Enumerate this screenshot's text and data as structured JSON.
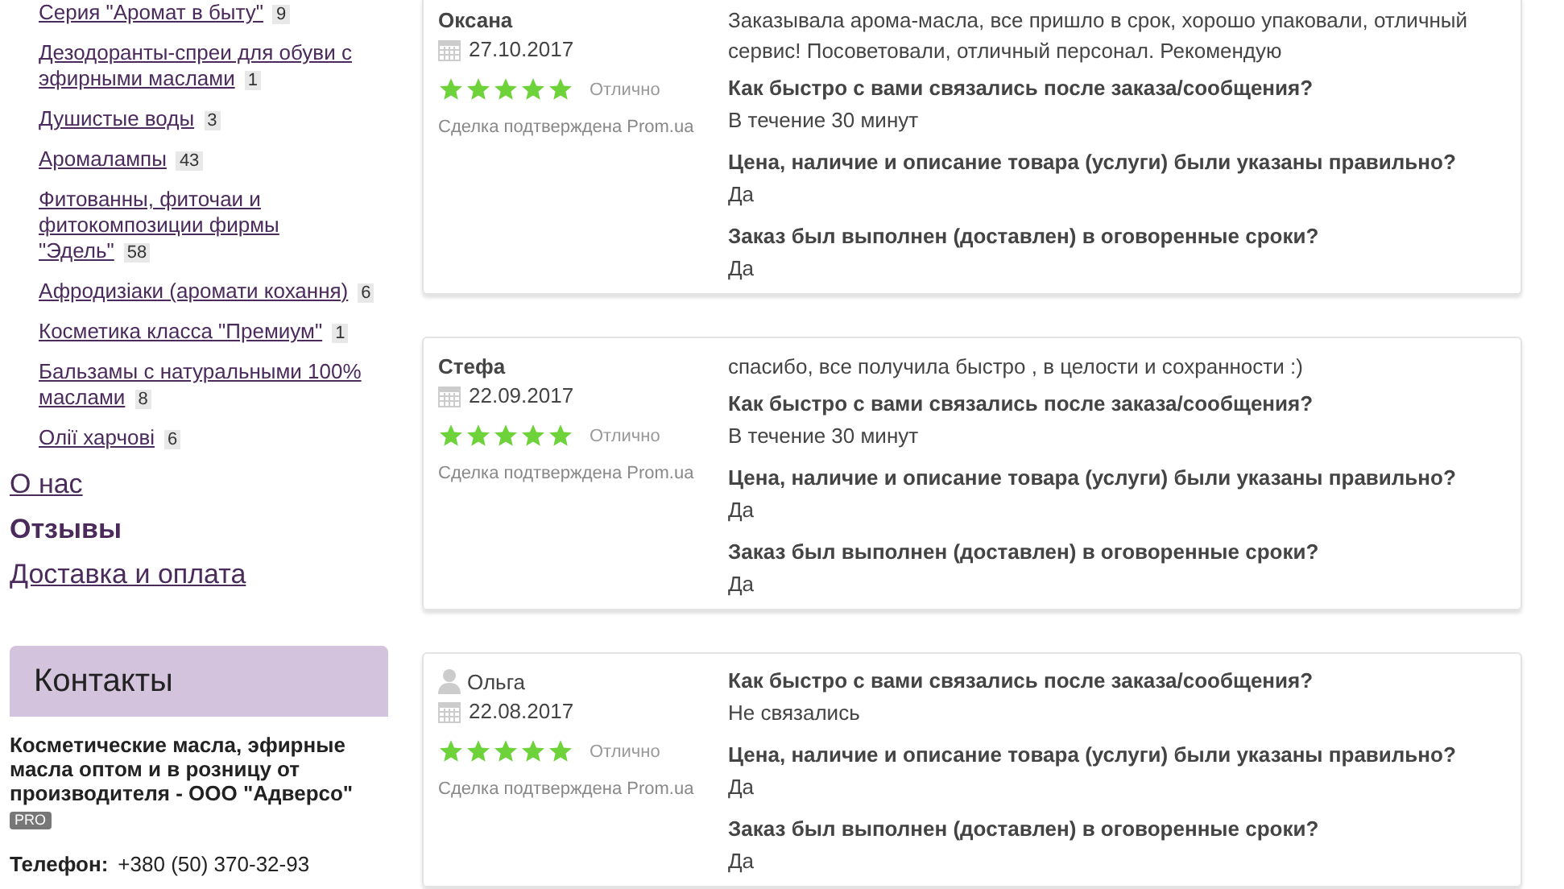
{
  "categories": [
    {
      "lines": [
        "Серия \"Аромат в быту\""
      ],
      "count": "9"
    },
    {
      "lines": [
        "Дезодоранты-спреи для обуви с",
        "эфирными маслами"
      ],
      "count": "1"
    },
    {
      "lines": [
        "Душистые воды"
      ],
      "count": "3"
    },
    {
      "lines": [
        "Аромалампы"
      ],
      "count": "43"
    },
    {
      "lines": [
        "Фитованны, фиточаи и",
        "фитокомпозиции фирмы",
        "\"Эдель\""
      ],
      "count": "58"
    },
    {
      "lines": [
        "Афродизіаки (аромати кохання)"
      ],
      "count": "6"
    },
    {
      "lines": [
        "Косметика класса \"Премиум\""
      ],
      "count": "1"
    },
    {
      "lines": [
        "Бальзамы с натуральными 100%",
        "маслами"
      ],
      "count": "8"
    },
    {
      "lines": [
        "Олії харчові"
      ],
      "count": "6"
    }
  ],
  "nav": [
    {
      "label": "О нас",
      "selected": false
    },
    {
      "label": "Отзывы",
      "selected": true
    },
    {
      "label": "Доставка и оплата",
      "selected": false
    }
  ],
  "contacts": {
    "title": "Контакты",
    "company": "Косметические масла, эфирные масла оптом и в розницу от производителя - ООО \"Адверсо\"",
    "badge": "PRO",
    "phone_label": "Телефон:",
    "phone": "+380 (50) 370-32-93"
  },
  "reviews": [
    {
      "name": "Оксана",
      "user_icon": false,
      "date": "27.10.2017",
      "stars": 5,
      "rating": "Отлично",
      "confirmed": "Сделка подтверждена Prom.ua",
      "text": "Заказывала арома-масла, все пришло в срок, хорошо упаковали, отличный сервис! Посоветовали, отличный персонал. Рекомендую",
      "answers": [
        {
          "question": "Как быстро с вами связались после заказа/сообщения?",
          "answer": "В течение 30 минут"
        },
        {
          "question": "Цена, наличие и описание товара (услуги) были указаны правильно?",
          "answer": "Да"
        },
        {
          "question": "Заказ был выполнен (доставлен) в оговоренные сроки?",
          "answer": "Да"
        }
      ]
    },
    {
      "name": "Стефа",
      "user_icon": false,
      "date": "22.09.2017",
      "stars": 5,
      "rating": "Отлично",
      "confirmed": "Сделка подтверждена Prom.ua",
      "text": "спасибо, все получила быстро , в целости и сохранности :)",
      "answers": [
        {
          "question": "Как быстро с вами связались после заказа/сообщения?",
          "answer": "В течение 30 минут"
        },
        {
          "question": "Цена, наличие и описание товара (услуги) были указаны правильно?",
          "answer": "Да"
        },
        {
          "question": "Заказ был выполнен (доставлен) в оговоренные сроки?",
          "answer": "Да"
        }
      ]
    },
    {
      "name": "Ольга",
      "user_icon": true,
      "date": "22.08.2017",
      "stars": 5,
      "rating": "Отлично",
      "confirmed": "Сделка подтверждена Prom.ua",
      "answers": [
        {
          "question": "Как быстро с вами связались после заказа/сообщения?",
          "answer": "Не связались"
        },
        {
          "question": "Цена, наличие и описание товара (услуги) были указаны правильно?",
          "answer": "Да"
        },
        {
          "question": "Заказ был выполнен (доставлен) в оговоренные сроки?",
          "answer": "Да"
        }
      ]
    }
  ]
}
